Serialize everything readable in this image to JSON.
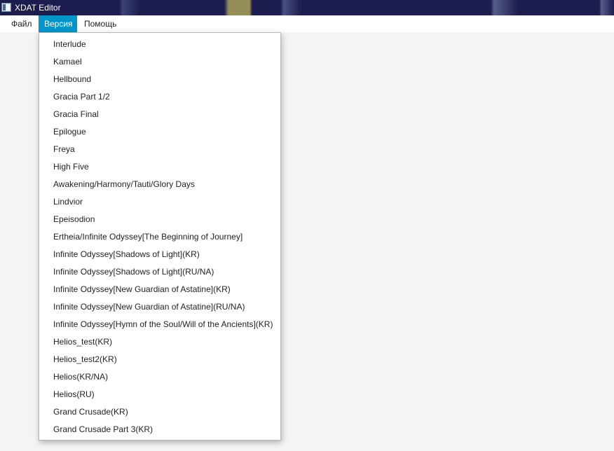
{
  "window": {
    "title": "XDAT Editor"
  },
  "menubar": {
    "items": [
      {
        "label": "Файл"
      },
      {
        "label": "Версия"
      },
      {
        "label": "Помощь"
      }
    ]
  },
  "version_menu": {
    "items": [
      "Interlude",
      "Kamael",
      "Hellbound",
      "Gracia Part 1/2",
      "Gracia Final",
      "Epilogue",
      "Freya",
      "High Five",
      "Awakening/Harmony/Tauti/Glory Days",
      "Lindvior",
      "Epeisodion",
      "Ertheia/Infinite Odyssey[The Beginning of Journey]",
      "Infinite Odyssey[Shadows of Light](KR)",
      "Infinite Odyssey[Shadows of Light](RU/NA)",
      "Infinite Odyssey[New Guardian of Astatine](KR)",
      "Infinite Odyssey[New Guardian of Astatine](RU/NA)",
      "Infinite Odyssey[Hymn of the Soul/Will of the Ancients](KR)",
      "Helios_test(KR)",
      "Helios_test2(KR)",
      "Helios(KR/NA)",
      "Helios(RU)",
      "Grand Crusade(KR)",
      "Grand Crusade Part 3(KR)"
    ]
  },
  "colors": {
    "accent": "#0096c9",
    "titlebar": "#1c1c4e",
    "background": "#f4f4f4"
  }
}
